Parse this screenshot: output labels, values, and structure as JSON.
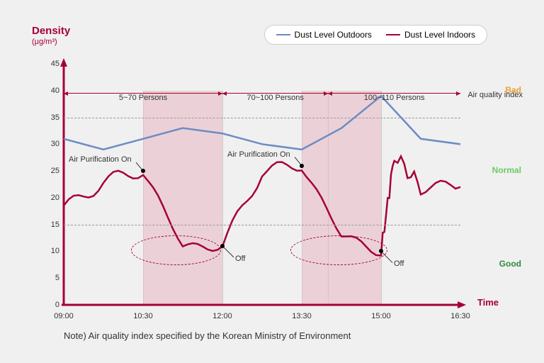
{
  "chart_data": {
    "type": "line",
    "title": "Density",
    "unit": "(μg/m³)",
    "xlabel": "Time",
    "ylabel": "Density (μg/m³)",
    "ylim": [
      0,
      45
    ],
    "yticks": [
      0,
      5,
      10,
      15,
      20,
      25,
      30,
      35,
      40,
      45
    ],
    "xticks": [
      "09:00",
      "10:30",
      "12:00",
      "13:30",
      "15:00",
      "16:30"
    ],
    "grid_lines_y": [
      15,
      35
    ],
    "series": [
      {
        "name": "Dust Level Outdoors",
        "color": "#6b8cc4",
        "x": [
          "09:00",
          "09:45",
          "10:30",
          "11:15",
          "12:00",
          "12:45",
          "13:30",
          "14:15",
          "15:00",
          "15:45",
          "16:30"
        ],
        "values": [
          31,
          29,
          31,
          33,
          32,
          30,
          29,
          33,
          39,
          31,
          30
        ]
      },
      {
        "name": "Dust Level Indoors",
        "color": "#a50034",
        "x": [
          "09:00",
          "09:45",
          "10:30",
          "11:15",
          "12:00",
          "12:45",
          "13:30",
          "14:15",
          "15:00",
          "15:15",
          "15:45",
          "16:30"
        ],
        "values": [
          18,
          23,
          25,
          11,
          11,
          25,
          26,
          13,
          10,
          28,
          22,
          22
        ]
      }
    ],
    "shaded_regions": [
      {
        "from": "10:30",
        "to": "12:00"
      },
      {
        "from": "13:30",
        "to": "15:00"
      }
    ],
    "vertical_markers": [
      "10:30",
      "12:00",
      "13:30",
      "14:00",
      "15:00"
    ],
    "period_bands": [
      {
        "from": "09:00",
        "to": "12:00",
        "label": "5~70 Persons"
      },
      {
        "from": "12:00",
        "to": "14:00",
        "label": "70~100 Persons"
      },
      {
        "from": "14:00",
        "to": "16:30",
        "label": "100~110 Persons"
      }
    ],
    "annotations": [
      {
        "x": "10:30",
        "y": 25,
        "label": "Air Purification On"
      },
      {
        "x": "12:00",
        "y": 11,
        "label": "Off"
      },
      {
        "x": "13:30",
        "y": 26,
        "label": "Air Purification On"
      },
      {
        "x": "15:00",
        "y": 10,
        "label": "Off"
      }
    ],
    "aqi_zones": [
      {
        "min": 35,
        "max": 45,
        "label": "Bad",
        "color": "#e8a03c"
      },
      {
        "min": 15,
        "max": 35,
        "label": "Normal",
        "color": "#6bc962"
      },
      {
        "min": 0,
        "max": 15,
        "label": "Good",
        "color": "#2e8b3f"
      }
    ],
    "aqi_title": "Air quality index"
  },
  "legend": {
    "items": [
      "Dust Level Outdoors",
      "Dust Level Indoors"
    ]
  },
  "note": "Note) Air quality index specified by the Korean Ministry of Environment"
}
